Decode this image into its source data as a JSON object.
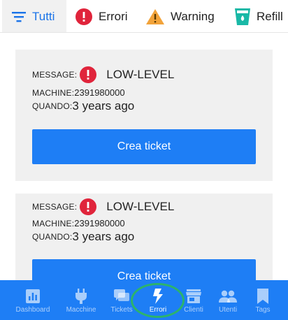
{
  "filter_tabs": [
    {
      "label": "Tutti",
      "icon": "filter-list-icon",
      "active": true
    },
    {
      "label": "Errori",
      "icon": "error-icon",
      "active": false
    },
    {
      "label": "Warning",
      "icon": "warning-icon",
      "active": false
    },
    {
      "label": "Refill",
      "icon": "refill-cup-icon",
      "active": false
    }
  ],
  "alerts": [
    {
      "message_label": "MESSAGE:",
      "message": "LOW-LEVEL",
      "machine_label": "MACHINE:",
      "machine": "2391980000",
      "when_label": "QUANDO:",
      "when": "3 years ago",
      "button": "Crea ticket"
    },
    {
      "message_label": "MESSAGE:",
      "message": "LOW-LEVEL",
      "machine_label": "MACHINE:",
      "machine": "2391980000",
      "when_label": "QUANDO:",
      "when": "3 years ago",
      "button": "Crea ticket"
    }
  ],
  "bottom_nav": [
    {
      "label": "Dashboard",
      "icon": "dashboard-icon"
    },
    {
      "label": "Macchine",
      "icon": "plug-icon"
    },
    {
      "label": "Tickets",
      "icon": "tickets-icon"
    },
    {
      "label": "Errori",
      "icon": "lightning-icon",
      "active": true
    },
    {
      "label": "Clienti",
      "icon": "store-icon"
    },
    {
      "label": "Utenti",
      "icon": "people-icon"
    },
    {
      "label": "Tags",
      "icon": "bookmark-icon"
    }
  ],
  "colors": {
    "accent": "#1e7ef5",
    "error": "#e0243b",
    "warning": "#f2a33a",
    "refill": "#19b8a6",
    "highlight": "#2db36b"
  }
}
